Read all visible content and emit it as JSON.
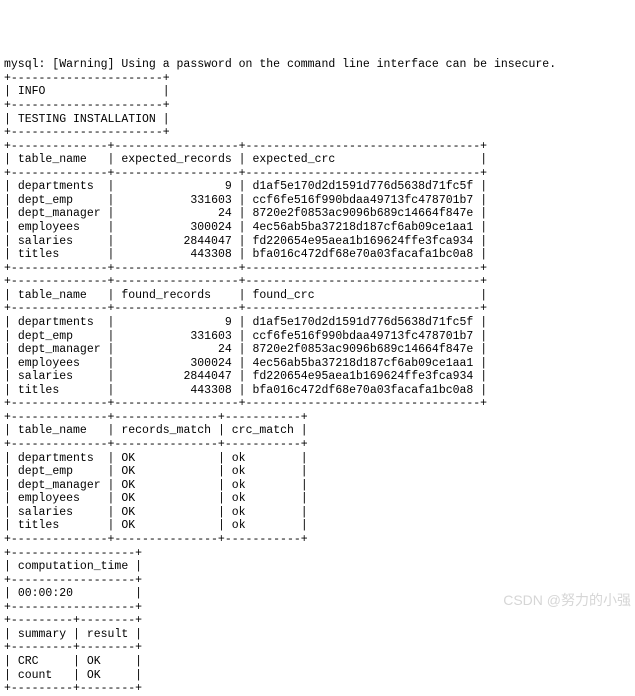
{
  "warning_line": "mysql: [Warning] Using a password on the command line interface can be insecure.",
  "info_block": {
    "row0": "INFO",
    "row1": "TESTING INSTALLATION"
  },
  "expected": {
    "headers": {
      "c0": "table_name",
      "c1": "expected_records",
      "c2": "expected_crc"
    },
    "rows": [
      {
        "c0": "departments",
        "c1": "9",
        "c2": "d1af5e170d2d1591d776d5638d71fc5f"
      },
      {
        "c0": "dept_emp",
        "c1": "331603",
        "c2": "ccf6fe516f990bdaa49713fc478701b7"
      },
      {
        "c0": "dept_manager",
        "c1": "24",
        "c2": "8720e2f0853ac9096b689c14664f847e"
      },
      {
        "c0": "employees",
        "c1": "300024",
        "c2": "4ec56ab5ba37218d187cf6ab09ce1aa1"
      },
      {
        "c0": "salaries",
        "c1": "2844047",
        "c2": "fd220654e95aea1b169624ffe3fca934"
      },
      {
        "c0": "titles",
        "c1": "443308",
        "c2": "bfa016c472df68e70a03facafa1bc0a8"
      }
    ]
  },
  "found": {
    "headers": {
      "c0": "table_name",
      "c1": "found_records",
      "c2": "found_crc"
    },
    "rows": [
      {
        "c0": "departments",
        "c1": "9",
        "c2": "d1af5e170d2d1591d776d5638d71fc5f"
      },
      {
        "c0": "dept_emp",
        "c1": "331603",
        "c2": "ccf6fe516f990bdaa49713fc478701b7"
      },
      {
        "c0": "dept_manager",
        "c1": "24",
        "c2": "8720e2f0853ac9096b689c14664f847e"
      },
      {
        "c0": "employees",
        "c1": "300024",
        "c2": "4ec56ab5ba37218d187cf6ab09ce1aa1"
      },
      {
        "c0": "salaries",
        "c1": "2844047",
        "c2": "fd220654e95aea1b169624ffe3fca934"
      },
      {
        "c0": "titles",
        "c1": "443308",
        "c2": "bfa016c472df68e70a03facafa1bc0a8"
      }
    ]
  },
  "match": {
    "headers": {
      "c0": "table_name",
      "c1": "records_match",
      "c2": "crc_match"
    },
    "rows": [
      {
        "c0": "departments",
        "c1": "OK",
        "c2": "ok"
      },
      {
        "c0": "dept_emp",
        "c1": "OK",
        "c2": "ok"
      },
      {
        "c0": "dept_manager",
        "c1": "OK",
        "c2": "ok"
      },
      {
        "c0": "employees",
        "c1": "OK",
        "c2": "ok"
      },
      {
        "c0": "salaries",
        "c1": "OK",
        "c2": "ok"
      },
      {
        "c0": "titles",
        "c1": "OK",
        "c2": "ok"
      }
    ]
  },
  "computation": {
    "header": "computation_time",
    "value": "00:00:20"
  },
  "summary": {
    "headers": {
      "c0": "summary",
      "c1": "result"
    },
    "rows": [
      {
        "c0": "CRC",
        "c1": "OK"
      },
      {
        "c0": "count",
        "c1": "OK"
      }
    ]
  },
  "watermark": "CSDN @努力的小强"
}
